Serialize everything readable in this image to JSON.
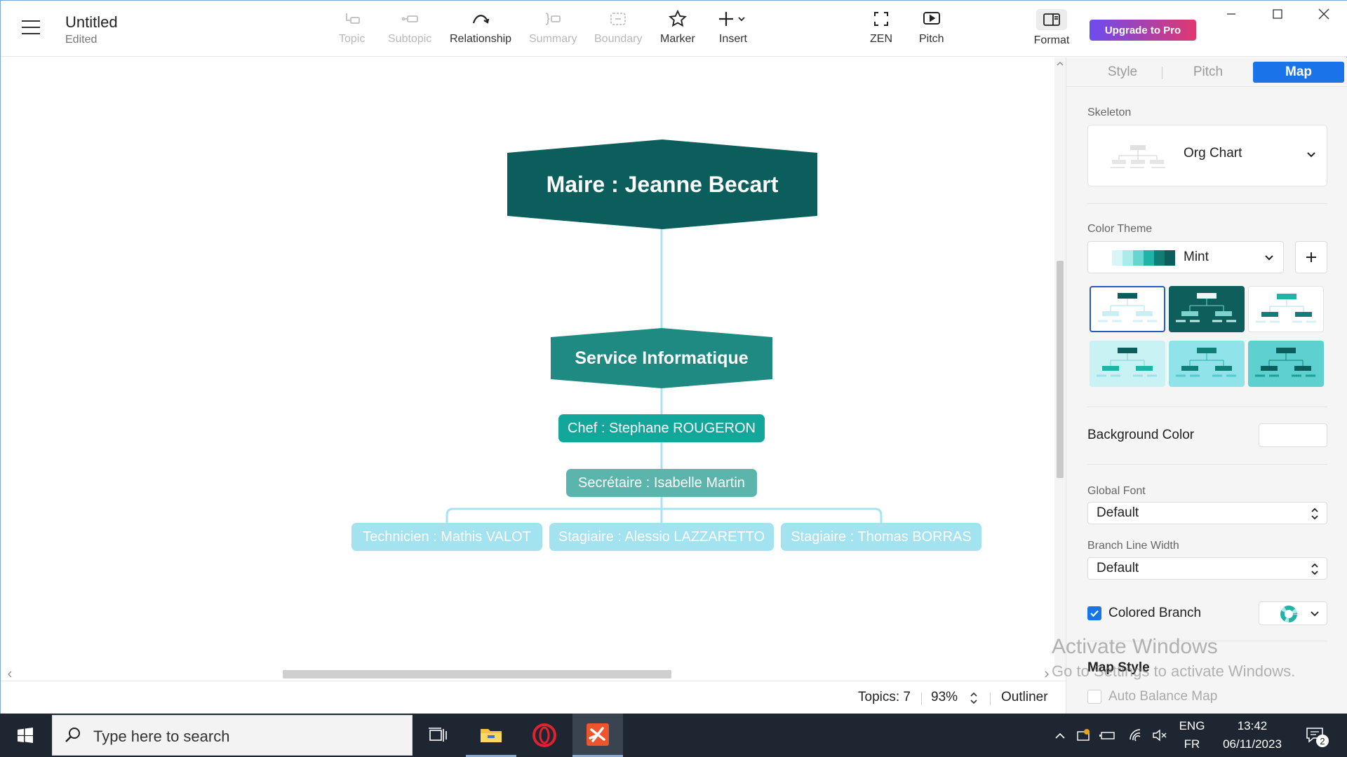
{
  "window": {
    "title": "Untitled",
    "subtitle": "Edited"
  },
  "toolbar": {
    "topic": "Topic",
    "subtopic": "Subtopic",
    "relationship": "Relationship",
    "summary": "Summary",
    "boundary": "Boundary",
    "marker": "Marker",
    "insert": "Insert",
    "zen": "ZEN",
    "pitch": "Pitch",
    "format": "Format",
    "upgrade": "Upgrade to Pro"
  },
  "map": {
    "central": "Maire : Jeanne Becart",
    "service": "Service Informatique",
    "chef": "Chef : Stephane ROUGERON",
    "secretaire": "Secrétaire : Isabelle Martin",
    "leaves": [
      "Technicien : Mathis VALOT",
      "Stagiaire : Alessio LAZZARETTO",
      "Stagiaire : Thomas BORRAS"
    ]
  },
  "status": {
    "topics": "Topics: 7",
    "zoom": "93%",
    "outliner": "Outliner"
  },
  "panel": {
    "tabs": [
      "Style",
      "Pitch",
      "Map"
    ],
    "active_tab": "Map",
    "skeleton_label": "Skeleton",
    "skeleton_value": "Org Chart",
    "color_theme_label": "Color Theme",
    "color_theme_value": "Mint",
    "background_color_label": "Background Color",
    "global_font_label": "Global Font",
    "global_font_value": "Default",
    "branch_line_width_label": "Branch Line Width",
    "branch_line_width_value": "Default",
    "colored_branch_label": "Colored Branch",
    "colored_branch_checked": true,
    "map_style_label": "Map Style",
    "auto_balance_label": "Auto Balance Map",
    "auto_balance_checked": false
  },
  "watermark": {
    "line1": "Activate Windows",
    "line2": "Go to Settings to activate Windows."
  },
  "taskbar": {
    "search_placeholder": "Type here to search",
    "lang_top": "ENG",
    "lang_bottom": "FR",
    "time": "13:42",
    "date": "06/11/2023",
    "notifications": "2"
  },
  "colors": {
    "central": "#0b5e5b",
    "service": "#1e8a82",
    "chef": "#13a79b",
    "secretaire": "#5bb5ad",
    "leaf": "#a3e2ef",
    "branch": "#a8e4ee",
    "accent": "#1a73e8"
  }
}
